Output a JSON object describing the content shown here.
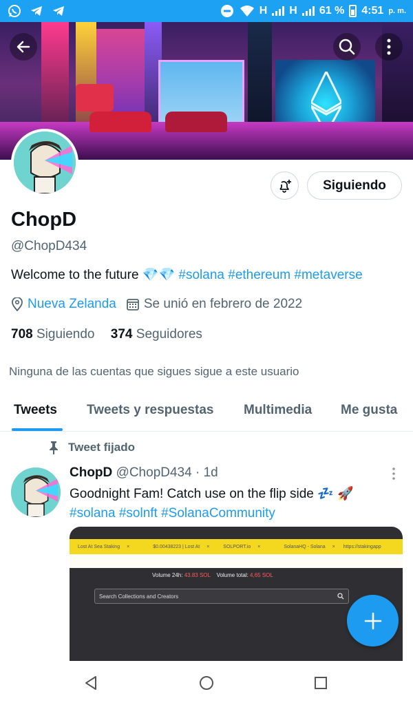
{
  "status_bar": {
    "net1": "H",
    "net2": "H",
    "battery": "61 %",
    "time": "4:51",
    "ampm": "p. m.",
    "icons": [
      "whatsapp-icon",
      "telegram-icon",
      "telegram-icon",
      "do-not-disturb-icon",
      "wifi-icon",
      "signal-icon",
      "battery-icon"
    ]
  },
  "header": {
    "back_icon": "arrow-left-icon",
    "search_icon": "search-icon",
    "more_icon": "more-vertical-icon"
  },
  "profile": {
    "follow_label": "Siguiendo",
    "notify_icon": "bell-plus-icon",
    "name": "ChopD",
    "handle": "@ChopD434",
    "bio_text": "Welcome to the future",
    "bio_emoji": "💎💎",
    "bio_tags": [
      "#solana",
      "#ethereum",
      "#metaverse"
    ],
    "location": "Nueva Zelanda",
    "joined": "Se unió en febrero de 2022",
    "following_count": "708",
    "following_label": "Siguiendo",
    "followers_count": "374",
    "followers_label": "Seguidores",
    "mutual_text": "Ninguna de las cuentas que sigues sigue a este usuario"
  },
  "tabs": [
    {
      "label": "Tweets",
      "active": true
    },
    {
      "label": "Tweets y respuestas",
      "active": false
    },
    {
      "label": "Multimedia",
      "active": false
    },
    {
      "label": "Me gusta",
      "active": false
    }
  ],
  "tweet": {
    "pinned_label": "Tweet fijado",
    "name": "ChopD",
    "handle": "@ChopD434",
    "sep": "·",
    "time": "1d",
    "text": "Goodnight Fam! Catch use on the flip side",
    "emoji": "💤 🚀",
    "tags": [
      "#solana",
      "#solnft",
      "#SolanaCommunity"
    ],
    "media": {
      "tab_labels": [
        "Lost At Sea Staking",
        "$0.00438223 | Lost At",
        "SOLPORT.io",
        "SolanaHQ - Solana",
        "https://stakingapp"
      ],
      "volume_24h_label": "Volume 24h:",
      "volume_24h_value": "43.83 SOL",
      "volume_total_label": "Volume total:",
      "volume_total_value": "4,65 SOL",
      "search_placeholder": "Search Collections and Creators"
    }
  },
  "fab": {
    "icon": "plus-icon"
  },
  "navbar": {
    "back": "nav-back-icon",
    "home": "nav-home-icon",
    "recents": "nav-recents-icon"
  }
}
